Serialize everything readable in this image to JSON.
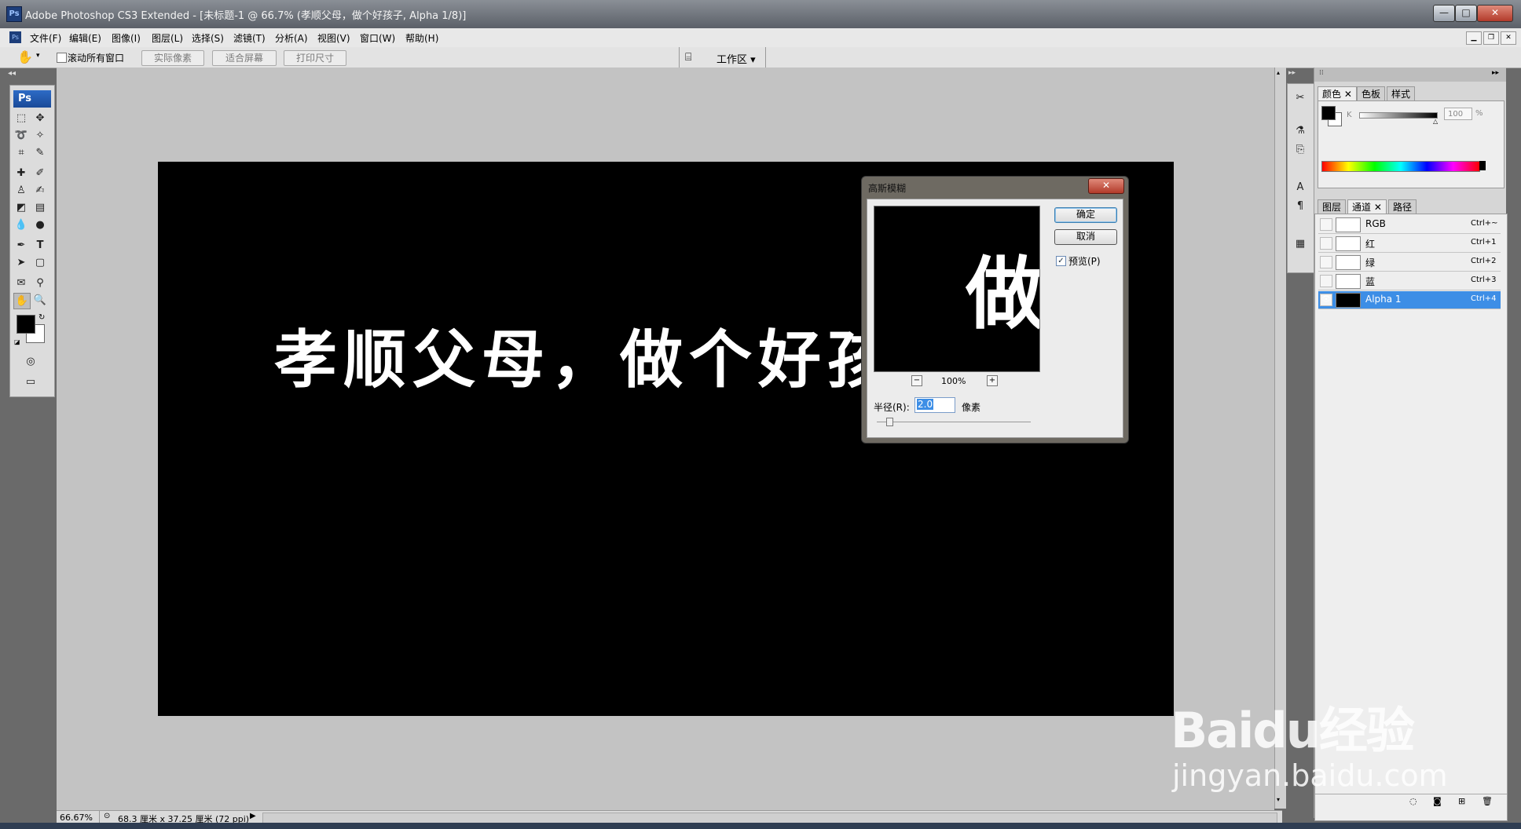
{
  "window": {
    "title": "Adobe Photoshop CS3 Extended - [未标题-1 @ 66.7% (孝顺父母，做个好孩子, Alpha 1/8)]",
    "app_icon": "Ps",
    "controls": [
      "—",
      "□",
      "✕"
    ]
  },
  "menu": [
    "文件(F)",
    "编辑(E)",
    "图像(I)",
    "图层(L)",
    "选择(S)",
    "滤镜(T)",
    "分析(A)",
    "视图(V)",
    "窗口(W)",
    "帮助(H)"
  ],
  "options_bar": {
    "checkbox_label": "滚动所有窗口",
    "buttons": [
      "实际像素",
      "适合屏幕",
      "打印尺寸"
    ],
    "workspace": "工作区 ▾"
  },
  "toolbox": {
    "logo": "Ps",
    "icons": [
      "marquee-icon",
      "move-icon",
      "lasso-icon",
      "magic-wand-icon",
      "crop-icon",
      "slice-icon",
      "healing-brush-icon",
      "brush-icon",
      "clone-stamp-icon",
      "history-brush-icon",
      "eraser-icon",
      "gradient-icon",
      "blur-icon",
      "dodge-icon",
      "pen-icon",
      "type-icon",
      "path-selection-icon",
      "shape-icon",
      "notes-icon",
      "eyedropper-icon",
      "hand-icon",
      "zoom-icon"
    ]
  },
  "canvas": {
    "text": "孝顺父母，做个好孩"
  },
  "dialog": {
    "title": "高斯模糊",
    "ok": "确定",
    "cancel": "取消",
    "preview_label": "预览(P)",
    "preview_checked": true,
    "preview_glyph": "做",
    "zoom": "100%",
    "radius_label": "半径(R):",
    "radius_value": "2.0",
    "radius_unit": "像素"
  },
  "panels": {
    "color_tabs": [
      "颜色",
      "色板",
      "样式"
    ],
    "k_label": "K",
    "k_value": "100",
    "k_unit": "%",
    "channel_tabs": [
      "图层",
      "通道",
      "路径"
    ],
    "channels": [
      {
        "name": "RGB",
        "shortcut": "Ctrl+~",
        "visible": false,
        "selected": false
      },
      {
        "name": "红",
        "shortcut": "Ctrl+1",
        "visible": false,
        "selected": false
      },
      {
        "name": "绿",
        "shortcut": "Ctrl+2",
        "visible": false,
        "selected": false
      },
      {
        "name": "蓝",
        "shortcut": "Ctrl+3",
        "visible": false,
        "selected": false
      },
      {
        "name": "Alpha 1",
        "shortcut": "Ctrl+4",
        "visible": true,
        "selected": true
      }
    ]
  },
  "status": {
    "zoom": "66.67%",
    "doc_size": "68.3 厘米 x 37.25 厘米 (72 ppi)"
  },
  "watermark": {
    "logo": "Baidu经验",
    "url": "jingyan.baidu.com"
  },
  "colors": {
    "selection": "#3d8ee6",
    "canvas": "#000000"
  }
}
